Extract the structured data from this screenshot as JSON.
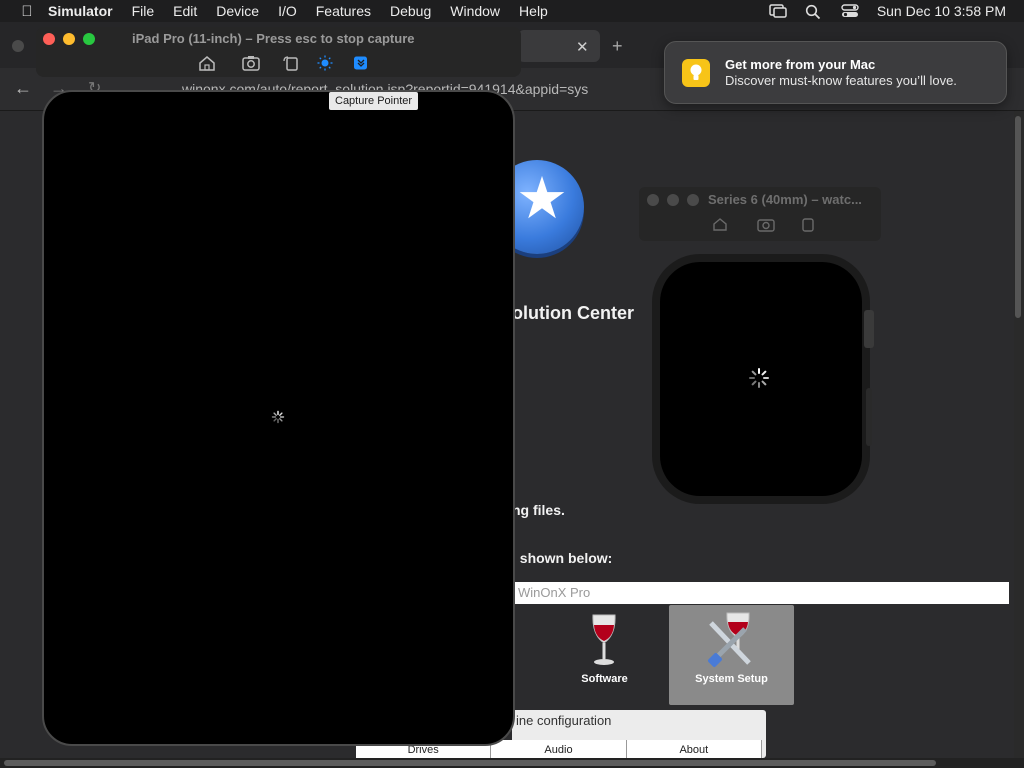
{
  "menubar": {
    "items": [
      "Simulator",
      "File",
      "Edit",
      "Device",
      "I/O",
      "Features",
      "Debug",
      "Window",
      "Help"
    ],
    "datetime": "Sun Dec 10  3:58 PM"
  },
  "browser": {
    "url": "winonx.com/auto/report_solution.jsp?reportid=941914&appid=sys"
  },
  "page": {
    "heading": "olution Center",
    "text_files": "ng files.",
    "text_shown": ", shown below:",
    "search_placeholder": "WinOnX Pro",
    "tiles": [
      "Software",
      "System Setup"
    ],
    "machine_config_title": "ine configuration",
    "machine_tabs": [
      "Drives",
      "Audio",
      "About"
    ]
  },
  "notification": {
    "title": "Get more from your Mac",
    "body": "Discover must-know features you’ll love."
  },
  "ipad_simulator": {
    "title": "iPad Pro (11-inch) – Press esc to stop capture",
    "tooltip": "Capture Pointer"
  },
  "watch_simulator": {
    "title": "Series 6 (40mm) – watc..."
  },
  "colors": {
    "traffic_red": "#fe5f57",
    "traffic_yellow": "#febc2e",
    "traffic_green": "#28c840",
    "accent_blue": "#1f8cff"
  }
}
